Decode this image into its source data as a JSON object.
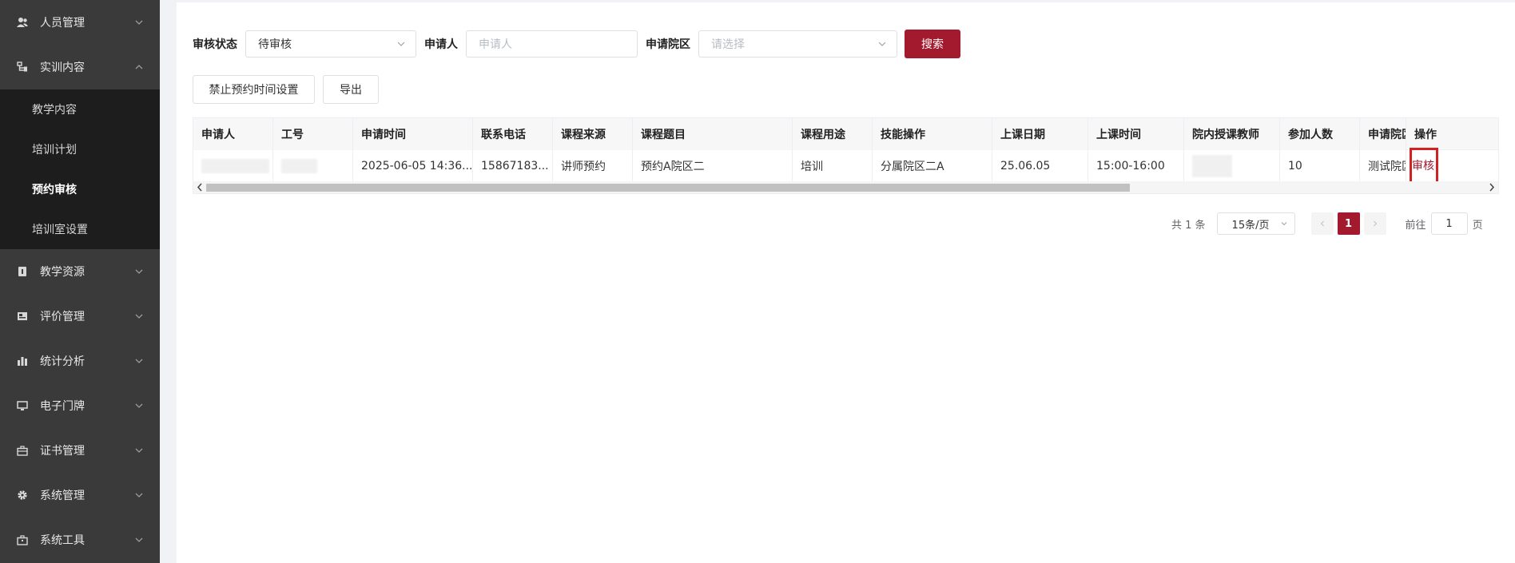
{
  "sidebar": {
    "items_top": [
      {
        "label": "人员管理",
        "icon": "users-icon",
        "expanded": false
      },
      {
        "label": "实训内容",
        "icon": "tree-icon",
        "expanded": true
      }
    ],
    "submenu": [
      {
        "label": "教学内容",
        "active": false
      },
      {
        "label": "培训计划",
        "active": false
      },
      {
        "label": "预约审核",
        "active": true
      },
      {
        "label": "培训室设置",
        "active": false
      }
    ],
    "items_bottom": [
      {
        "label": "教学资源",
        "icon": "book-icon"
      },
      {
        "label": "评价管理",
        "icon": "evaluation-icon"
      },
      {
        "label": "统计分析",
        "icon": "bar-chart-icon"
      },
      {
        "label": "电子门牌",
        "icon": "monitor-icon"
      },
      {
        "label": "证书管理",
        "icon": "briefcase-icon"
      },
      {
        "label": "系统管理",
        "icon": "gear-icon"
      },
      {
        "label": "系统工具",
        "icon": "toolbox-icon"
      }
    ]
  },
  "filters": {
    "status_label": "审核状态",
    "status_value": "待审核",
    "applicant_label": "申请人",
    "applicant_placeholder": "申请人",
    "campus_label": "申请院区",
    "campus_placeholder": "请选择",
    "search_button": "搜索"
  },
  "actions": {
    "forbid_button": "禁止预约时间设置",
    "export_button": "导出"
  },
  "table": {
    "headers": [
      "申请人",
      "工号",
      "申请时间",
      "联系电话",
      "课程来源",
      "课程题目",
      "课程用途",
      "技能操作",
      "上课日期",
      "上课时间",
      "院内授课教师",
      "参加人数",
      "申请院区"
    ],
    "op_header": "操作",
    "rows": [
      {
        "cells": [
          "",
          "",
          "2025-06-05 14:36...",
          "15867183...",
          "讲师预约",
          "预约A院区二",
          "培训",
          "分属院区二A",
          "25.06.05",
          "15:00-16:00",
          "",
          "10",
          "测试院区"
        ],
        "op_label": "审核"
      }
    ]
  },
  "pagination": {
    "total": "共 1 条",
    "page_size": "15条/页",
    "current_page": "1",
    "goto_label": "前往",
    "goto_value": "1",
    "page_suffix": "页"
  },
  "colors": {
    "accent": "#a3192d",
    "sidebar_bg": "#3a3a3a",
    "submenu_bg": "#1d1d1d",
    "highlight_box": "#d42020"
  }
}
